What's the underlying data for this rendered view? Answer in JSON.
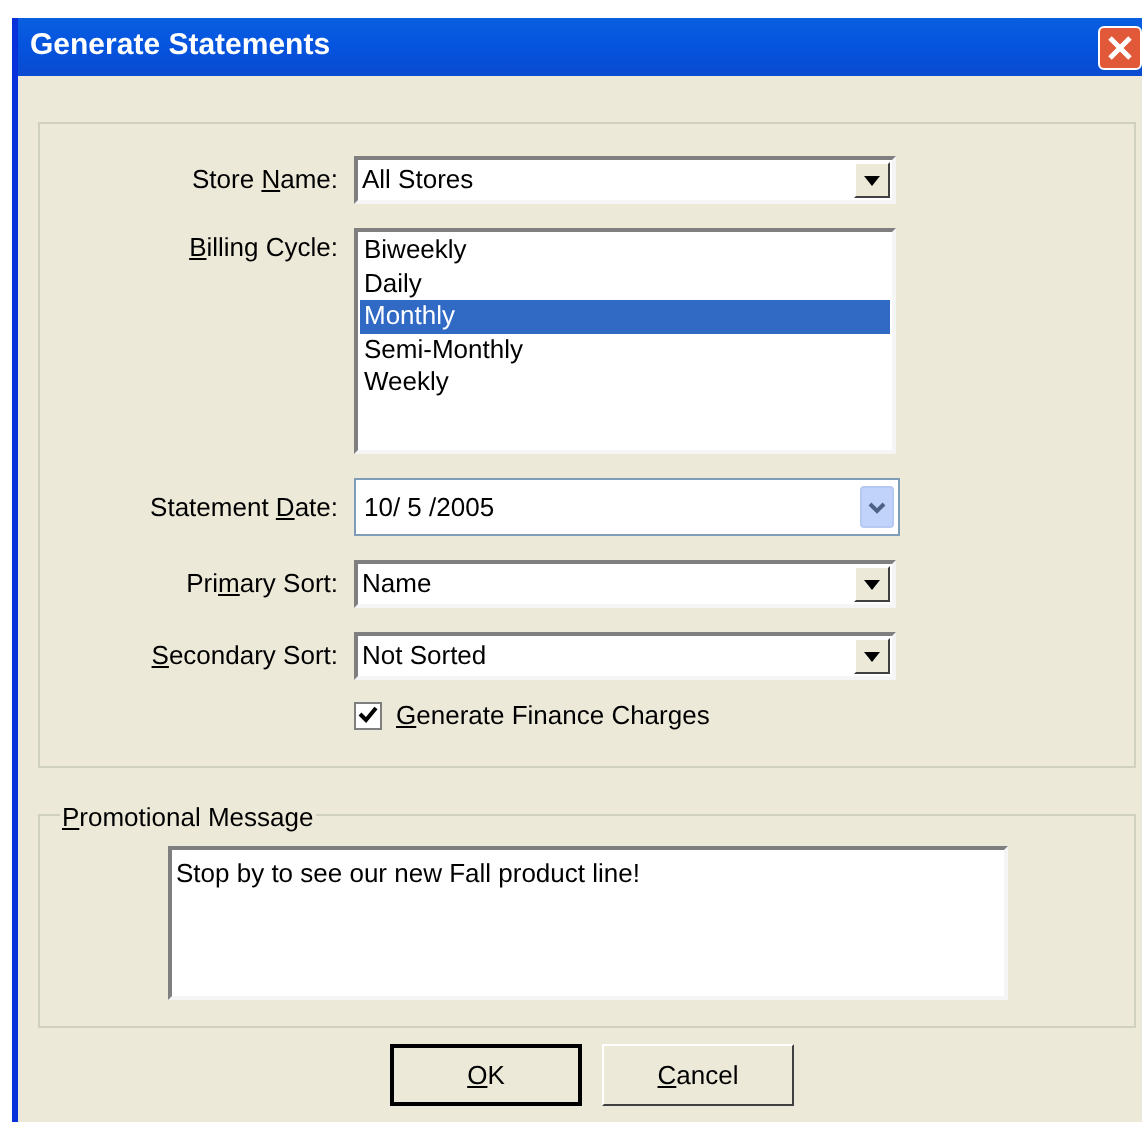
{
  "window": {
    "title": "Generate Statements"
  },
  "fields": [
    {
      "kind": "dropdown",
      "label": {
        "pre": "Store ",
        "key": "N",
        "post": "ame:"
      },
      "value": "All Stores"
    },
    {
      "kind": "listbox",
      "label": {
        "key": "B",
        "post": "illing Cycle:"
      },
      "items": [
        {
          "text": "Biweekly",
          "selected": false
        },
        {
          "text": "Daily",
          "selected": false
        },
        {
          "text": "Monthly",
          "selected": true
        },
        {
          "text": "Semi-Monthly",
          "selected": false
        },
        {
          "text": "Weekly",
          "selected": false
        }
      ]
    },
    {
      "kind": "date",
      "label": {
        "pre": "Statement ",
        "key": "D",
        "post": "ate:"
      },
      "value": "10/ 5 /2005"
    },
    {
      "kind": "dropdown",
      "label": {
        "pre": "Pri",
        "key": "m",
        "post": "ary Sort:"
      },
      "value": "Name"
    },
    {
      "kind": "dropdown",
      "label": {
        "key": "S",
        "post": "econdary Sort:"
      },
      "value": "Not Sorted"
    }
  ],
  "finance_charges": {
    "label": {
      "key": "G",
      "post": "enerate Finance Charges"
    },
    "checked": true
  },
  "promotional_message": {
    "legend": {
      "key": "P",
      "post": "romotional Message"
    },
    "value": "Stop by to see our new Fall product line!"
  },
  "buttons": [
    {
      "label": {
        "key": "O",
        "post": "K"
      },
      "default": true
    },
    {
      "label": {
        "key": "C",
        "post": "ancel"
      },
      "default": false
    }
  ]
}
